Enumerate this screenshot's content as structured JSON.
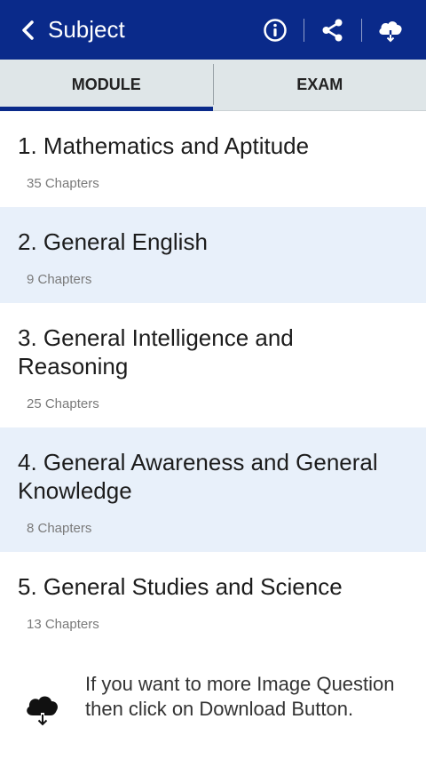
{
  "appbar": {
    "title": "Subject",
    "icons": {
      "back": "chevron-left-icon",
      "info": "info-icon",
      "share": "share-icon",
      "download": "cloud-download-icon"
    }
  },
  "tabs": [
    {
      "label": "MODULE",
      "active": true
    },
    {
      "label": "EXAM",
      "active": false
    }
  ],
  "subjects": [
    {
      "title": "1. Mathematics and Aptitude",
      "chapters": "35 Chapters"
    },
    {
      "title": "2. General English",
      "chapters": "9 Chapters"
    },
    {
      "title": "3. General Intelligence and Reasoning",
      "chapters": "25 Chapters"
    },
    {
      "title": "4. General Awareness and General Knowledge",
      "chapters": "8 Chapters"
    },
    {
      "title": "5. General Studies and Science",
      "chapters": "13 Chapters"
    }
  ],
  "footer": {
    "text": "If you want to more Image Question then click on Download Button.",
    "icon": "cloud-download-icon"
  },
  "colors": {
    "primary": "#0a2a8a",
    "tab_background": "#dfe6e8",
    "alt_row": "#e8f0fa"
  }
}
